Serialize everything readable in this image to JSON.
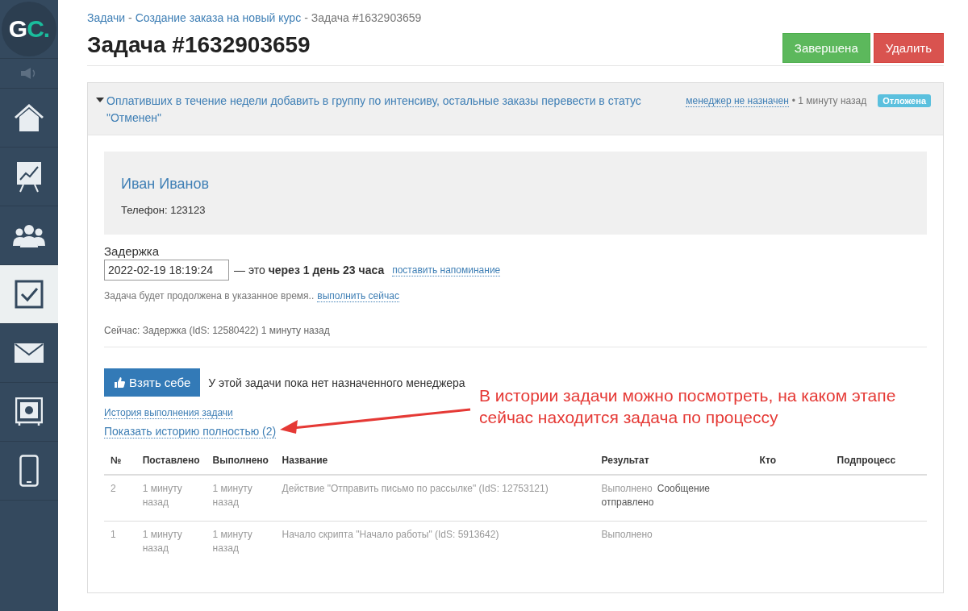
{
  "sidebar": {
    "logo": {
      "letters": "G",
      "accent": "C."
    },
    "items": [
      {
        "kind": "home",
        "selected": false
      },
      {
        "kind": "chart",
        "selected": false
      },
      {
        "kind": "users",
        "selected": false
      },
      {
        "kind": "tasks",
        "selected": true
      },
      {
        "kind": "mail",
        "selected": false
      },
      {
        "kind": "safe",
        "selected": false
      },
      {
        "kind": "phone",
        "selected": false
      }
    ]
  },
  "breadcrumbs": [
    {
      "label": "Задачи",
      "link": true,
      "separator": "-"
    },
    {
      "label": "Создание заказа на новый курс",
      "link": true,
      "separator": "-"
    },
    {
      "label": "Задача #1632903659",
      "link": false
    }
  ],
  "title": "Задача #1632903659",
  "buttons": [
    {
      "label": "Завершена",
      "kind": "success"
    },
    {
      "label": "Удалить",
      "kind": "danger"
    }
  ],
  "task": {
    "description": "Оплативших в течение недели добавить в группу по интенсиву, остальные заказы перевести в статус \"Отменен\"",
    "expanded": true,
    "manager": "менеджер не назначен",
    "time": "• 1 минуту назад",
    "status": "Отложена"
  },
  "contact": {
    "name": "Иван Иванов",
    "phone": "Телефон: 123123"
  },
  "delay": {
    "label": "Задержка",
    "value": "2022-02-19 18:19:24",
    "text": "— это **через 1 день 23 часа**",
    "reminder": "поставить напоминание",
    "note": "Задача будет продолжена в указанное время..",
    "run_now": "выполнить сейчас",
    "current": "Сейчас: Задержка (IdS: 12580422) 1 минуту назад"
  },
  "take_button": "Взять себе",
  "no_manager": "У этой задачи пока нет назначенного менеджера",
  "history_link": "История выполнения задачи",
  "show_all_link": "Показать историю полностью (2)",
  "annotation": "В истории задачи можно посмотреть, на каком этапе сейчас находится задача по процессу",
  "table": {
    "columns": [
      "№",
      "Поставлено",
      "Выполнено",
      "Название",
      "Результат",
      "Кто",
      "Подпроцесс"
    ],
    "rows": [
      {
        "num": "2",
        "set": "1 минуту назад",
        "done": "1 минуту назад",
        "name": "Действие \"Отправить письмо по рассылке\" (IdS: 12753121)",
        "result": "Выполнено",
        "message": "Сообщение отправлено"
      },
      {
        "num": "1",
        "set": "1 минуту назад",
        "done": "1 минуту назад",
        "name": "Начало скрипта \"Начало работы\" (IdS: 5913642)",
        "result": "Выполнено"
      }
    ]
  }
}
